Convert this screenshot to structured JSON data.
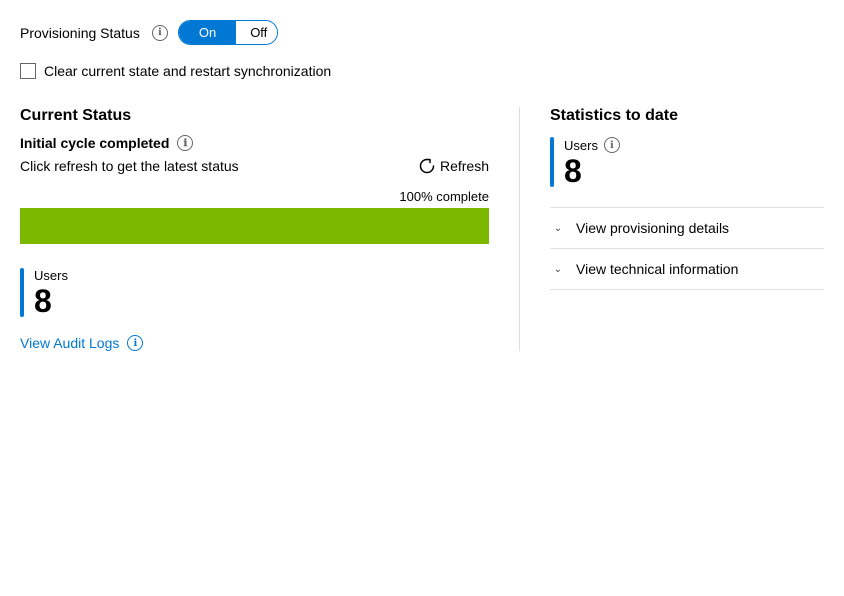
{
  "provisioning": {
    "label": "Provisioning Status",
    "toggle_on": "On",
    "toggle_off": "Off",
    "info_icon": "ℹ"
  },
  "checkbox": {
    "label": "Clear current state and restart synchronization"
  },
  "current_status": {
    "title": "Current Status",
    "cycle_label": "Initial cycle completed",
    "info_icon": "ℹ",
    "refresh_hint": "Click refresh to get the latest status",
    "refresh_label": "Refresh",
    "progress_label": "100% complete",
    "progress_pct": 100
  },
  "left_users": {
    "label": "Users",
    "count": "8"
  },
  "audit_logs": {
    "label": "View Audit Logs",
    "info_icon": "ℹ"
  },
  "stats": {
    "title": "Statistics to date",
    "users_label": "Users",
    "users_info": "ℹ",
    "users_count": "8"
  },
  "expand_items": [
    {
      "label": "View provisioning details"
    },
    {
      "label": "View technical information"
    }
  ]
}
